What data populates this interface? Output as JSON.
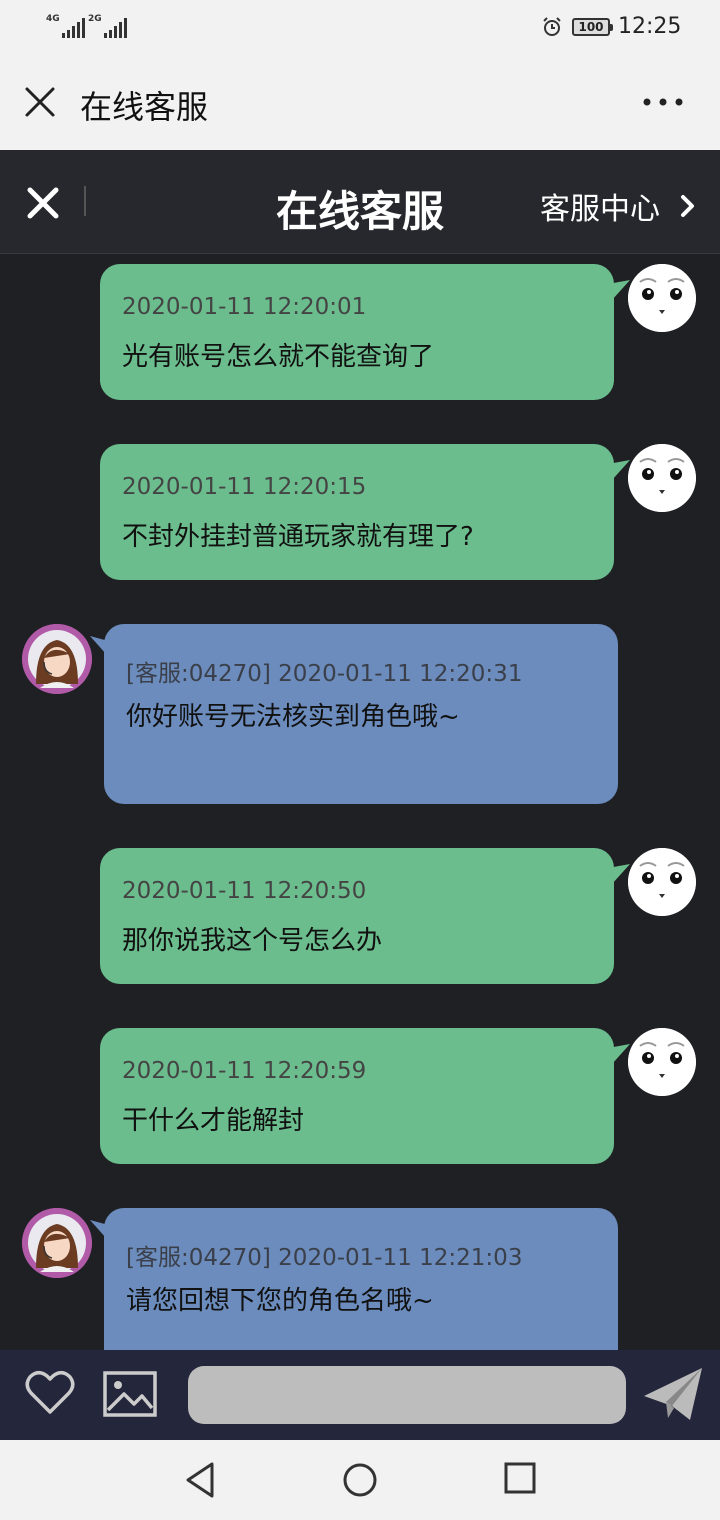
{
  "status_bar": {
    "sim1": "4G",
    "sim2": "2G",
    "battery": "100",
    "time": "12:25"
  },
  "app_header": {
    "title": "在线客服"
  },
  "chat_header": {
    "title": "在线客服",
    "service_center": "客服中心"
  },
  "messages": [
    {
      "sender": "user",
      "timestamp": "2020-01-11 12:20:01",
      "text": "光有账号怎么就不能查询了"
    },
    {
      "sender": "user",
      "timestamp": "2020-01-11 12:20:15",
      "text": "不封外挂封普通玩家就有理了?"
    },
    {
      "sender": "agent",
      "timestamp": "[客服:04270] 2020-01-11 12:20:31",
      "text": "你好账号无法核实到角色哦~"
    },
    {
      "sender": "user",
      "timestamp": "2020-01-11 12:20:50",
      "text": "那你说我这个号怎么办"
    },
    {
      "sender": "user",
      "timestamp": "2020-01-11 12:20:59",
      "text": "干什么才能解封"
    },
    {
      "sender": "agent",
      "timestamp": "[客服:04270] 2020-01-11 12:21:03",
      "text": "请您回想下您的角色名哦~"
    }
  ],
  "input": {
    "value": "",
    "placeholder": ""
  },
  "colors": {
    "user_bubble": "#6bbd8d",
    "agent_bubble": "#6b8cbd",
    "chat_bg": "#1f2024"
  }
}
